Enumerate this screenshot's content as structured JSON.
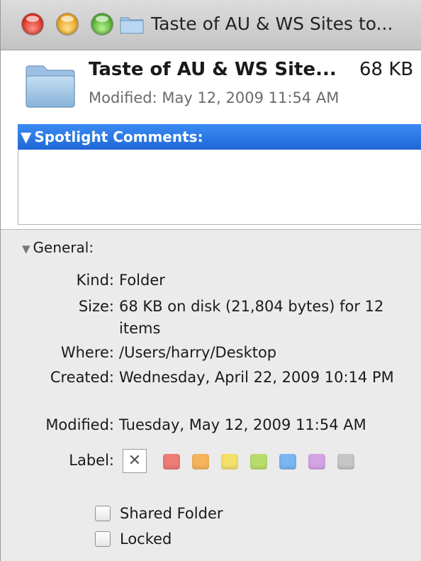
{
  "window": {
    "title": "Taste of AU & WS Sites to..."
  },
  "header": {
    "file_name": "Taste of AU & WS Site...",
    "file_size": "68 KB",
    "modified": "Modified: May 12, 2009 11:54 AM"
  },
  "spotlight": {
    "toggle": "▼",
    "heading": "Spotlight Comments:",
    "comment_value": ""
  },
  "general": {
    "toggle": "▼",
    "heading": "General:",
    "kind_key": "Kind:",
    "kind_value": "Folder",
    "size_key": "Size:",
    "size_value": "68 KB on disk (21,804 bytes) for 12 items",
    "where_key": "Where:",
    "where_value": "/Users/harry/Desktop",
    "created_key": "Created:",
    "created_value": "Wednesday, April 22, 2009 10:14 PM",
    "modified_key": "Modified:",
    "modified_value": "Tuesday, May 12, 2009 11:54 AM",
    "label_key": "Label:",
    "label_none": "✕",
    "label_colors": [
      "#ef7b76",
      "#f5b45c",
      "#f5e06a",
      "#b9dd6a",
      "#79b6f2",
      "#d4a3e6",
      "#c6c6c6"
    ],
    "shared_folder": "Shared Folder",
    "locked": "Locked"
  },
  "colors": {
    "selection_blue": "#2a75e2",
    "close": "#e0443a",
    "minimize": "#f2b233",
    "zoom": "#62bf3e"
  }
}
